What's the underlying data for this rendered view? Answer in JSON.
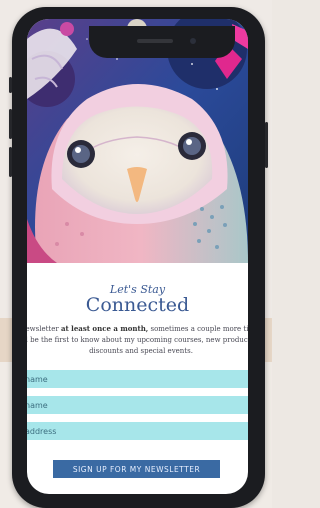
{
  "background": {
    "partial_text": "newsletter at least once a month"
  },
  "signup": {
    "script_title": "Let's Stay",
    "title": "Connected",
    "body_line1_pre": "newsletter ",
    "body_line1_bold": "at least once a month,",
    "body_line1_post": " sometimes a couple more times",
    "body_line2": "l be the first to know about my upcoming courses, new products, ",
    "body_line3": "discounts and special events.",
    "fields": [
      {
        "placeholder": "name"
      },
      {
        "placeholder": "name"
      },
      {
        "placeholder": "address"
      }
    ],
    "submit_label": "SIGN UP FOR MY NEWSLETTER"
  },
  "colors": {
    "accent": "#3a6aa3",
    "field_bg": "#a7e6ea",
    "title": "#3b5a93"
  }
}
